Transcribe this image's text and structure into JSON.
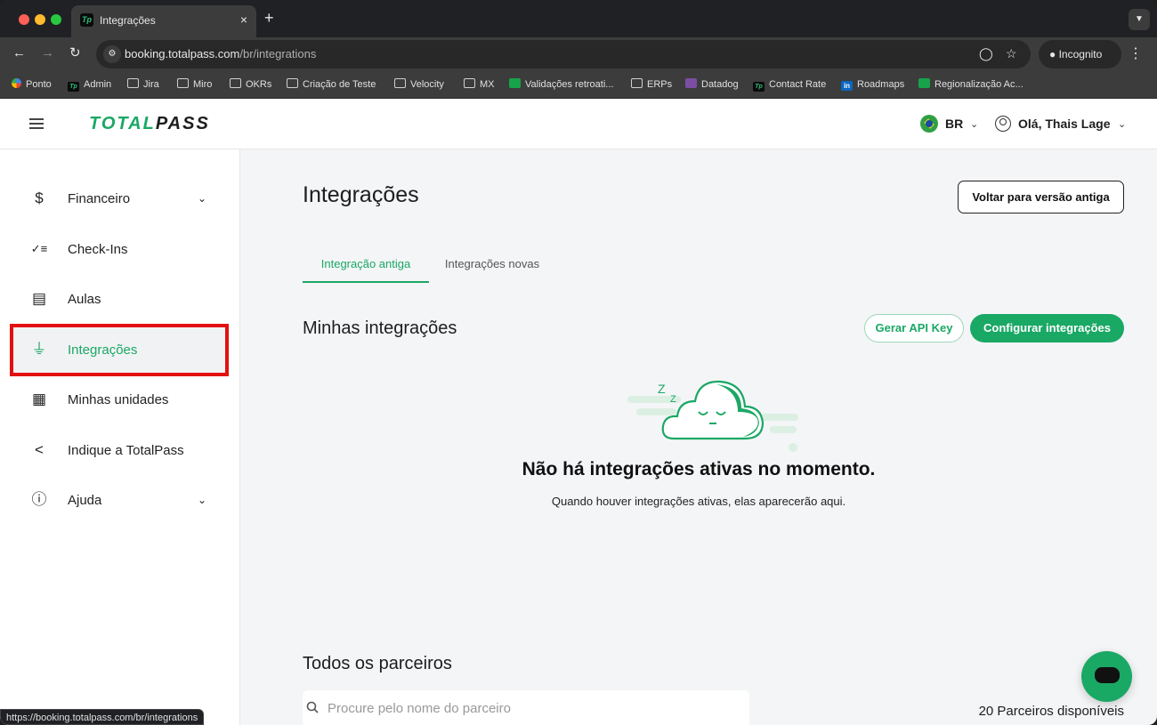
{
  "browser": {
    "tab_title": "Integrações",
    "tab_close": "×",
    "new_tab": "+",
    "url_host": "booking.totalpass.com",
    "url_path": "/br/integrations",
    "incognito_label": "Incognito",
    "status_url": "https://booking.totalpass.com/br/integrations",
    "bookmarks": [
      {
        "label": "Ponto",
        "icon": "ponto"
      },
      {
        "label": "Admin",
        "icon": "tp"
      },
      {
        "label": "Jira",
        "icon": "folder"
      },
      {
        "label": "Miro",
        "icon": "folder"
      },
      {
        "label": "OKRs",
        "icon": "folder"
      },
      {
        "label": "Criação de Teste",
        "icon": "folder"
      },
      {
        "label": "Velocity",
        "icon": "folder"
      },
      {
        "label": "MX",
        "icon": "folder"
      },
      {
        "label": "Validações retroati...",
        "icon": "sheet"
      },
      {
        "label": "ERPs",
        "icon": "folder"
      },
      {
        "label": "Datadog",
        "icon": "datadog"
      },
      {
        "label": "Contact Rate",
        "icon": "tp"
      },
      {
        "label": "Roadmaps",
        "icon": "in"
      },
      {
        "label": "Regionalização Ac...",
        "icon": "sheet"
      }
    ]
  },
  "header": {
    "logo_green": "TOTAL",
    "logo_dark": "PASS",
    "country": "BR",
    "greeting": "Olá, Thais Lage"
  },
  "sidebar": {
    "items": [
      {
        "label": "Financeiro",
        "icon": "dollar-icon",
        "expandable": true
      },
      {
        "label": "Check-Ins",
        "icon": "checklist-icon",
        "expandable": false
      },
      {
        "label": "Aulas",
        "icon": "calendar-edit-icon",
        "expandable": false
      },
      {
        "label": "Integrações",
        "icon": "plug-icon",
        "expandable": false,
        "active": true
      },
      {
        "label": "Minhas unidades",
        "icon": "store-icon",
        "expandable": false
      },
      {
        "label": "Indique a TotalPass",
        "icon": "share-icon",
        "expandable": false
      },
      {
        "label": "Ajuda",
        "icon": "help-icon",
        "expandable": true
      }
    ]
  },
  "main": {
    "title": "Integrações",
    "old_version_button": "Voltar para versão antiga",
    "tabs": [
      {
        "label": "Integração antiga",
        "active": true
      },
      {
        "label": "Integrações novas",
        "active": false
      }
    ],
    "my_integrations_title": "Minhas integrações",
    "api_key_button": "Gerar API Key",
    "configure_button": "Configurar integrações",
    "empty_title": "Não há integrações ativas no momento.",
    "empty_subtitle": "Quando houver integrações ativas, elas aparecerão aqui.",
    "all_partners_title": "Todos os parceiros",
    "search_placeholder": "Procure pelo nome do parceiro",
    "partners_count": "20 Parceiros disponíveis"
  },
  "colors": {
    "brand_green": "#1aa865",
    "highlight_red": "#e31010"
  }
}
